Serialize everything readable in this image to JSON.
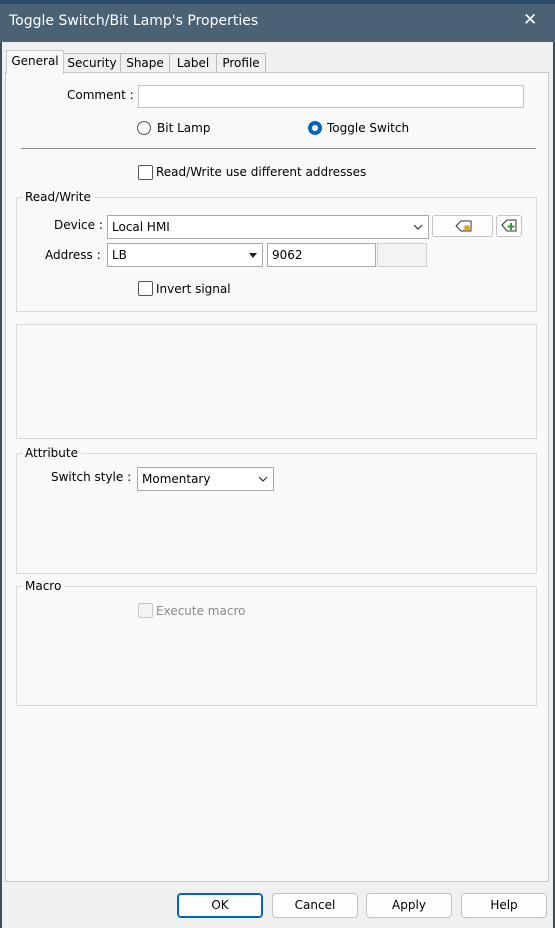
{
  "window": {
    "title": "Toggle Switch/Bit Lamp's Properties",
    "close_glyph": "✕"
  },
  "tabs": [
    {
      "label": "General"
    },
    {
      "label": "Security"
    },
    {
      "label": "Shape"
    },
    {
      "label": "Label"
    },
    {
      "label": "Profile"
    }
  ],
  "general": {
    "comment_label": "Comment :",
    "comment_value": "",
    "type_options": {
      "bit_lamp": "Bit Lamp",
      "toggle_switch": "Toggle Switch",
      "selected": "Toggle Switch"
    },
    "rw_diff_label": "Read/Write use different addresses",
    "rw_diff_checked": false
  },
  "read_write": {
    "group_title": "Read/Write",
    "device_label": "Device :",
    "device_value": "Local HMI",
    "address_label": "Address :",
    "address_type": "LB",
    "address_value": "9062",
    "invert_label": "Invert signal",
    "invert_checked": false
  },
  "attribute": {
    "group_title": "Attribute",
    "switch_style_label": "Switch style :",
    "switch_style_value": "Momentary"
  },
  "macro": {
    "group_title": "Macro",
    "execute_label": "Execute macro",
    "execute_checked": false,
    "execute_enabled": false
  },
  "buttons": {
    "ok": "OK",
    "cancel": "Cancel",
    "apply": "Apply",
    "help": "Help"
  },
  "colors": {
    "titlebar": "#4a6274",
    "accent": "#0067c0",
    "panel": "#f9f9f9",
    "dialog": "#f0f0f0"
  }
}
